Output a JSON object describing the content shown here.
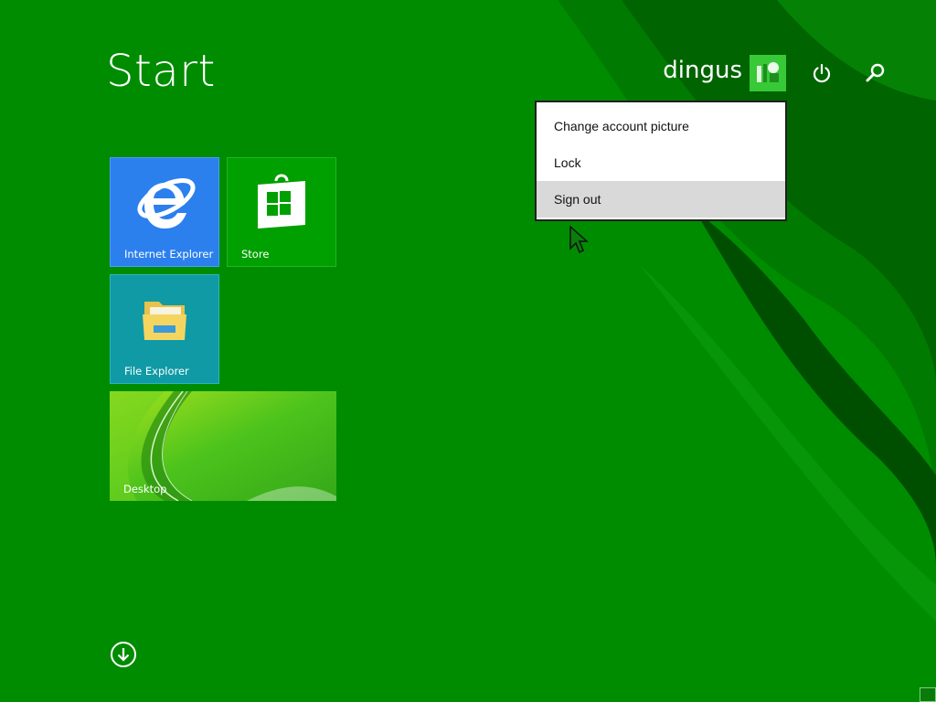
{
  "start": {
    "title": "Start"
  },
  "user": {
    "name": "dingus"
  },
  "header_icons": {
    "power": "power-icon",
    "search": "search-icon"
  },
  "tiles": [
    {
      "id": "ie",
      "label": "Internet Explorer",
      "color": "#2b80ee",
      "icon": "internet-explorer-icon"
    },
    {
      "id": "store",
      "label": "Store",
      "color": "#00a000",
      "icon": "store-icon"
    },
    {
      "id": "file_explorer",
      "label": "File Explorer",
      "color": "#0f9aa6",
      "icon": "file-explorer-icon"
    },
    {
      "id": "desktop",
      "label": "Desktop",
      "color": "#4cc31c",
      "icon": "desktop-wallpaper"
    }
  ],
  "account_menu": {
    "items": [
      {
        "label": "Change account picture"
      },
      {
        "label": "Lock"
      },
      {
        "label": "Sign out",
        "highlighted": true
      }
    ]
  },
  "apps_view": {
    "icon": "arrow-down-circle-icon"
  },
  "colors": {
    "background": "#008c00",
    "accent": "#00a000"
  }
}
